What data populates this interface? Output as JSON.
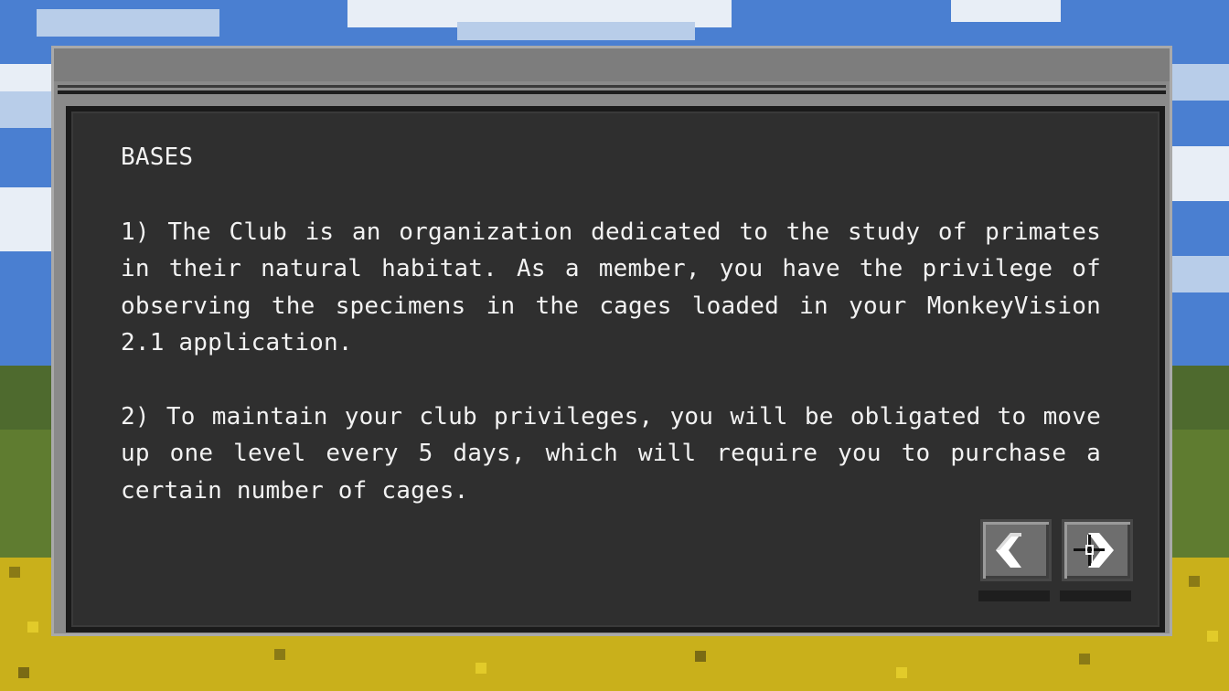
{
  "dialog": {
    "heading": "BASES",
    "paragraphs": [
      "1) The Club is an organization dedicated to the study of primates in their natural habitat. As a member, you have the privilege of observing the specimens in the cages loaded in your MonkeyVision 2.1 application.",
      "2) To maintain your club privileges, you will be obligated to move up one level every 5 days, which will require you to purchase a certain number of cages."
    ]
  },
  "navigation": {
    "previous_icon": "chevron-left-icon",
    "next_icon": "chevron-right-icon",
    "cursor_icon": "crosshair-cursor-icon"
  },
  "colors": {
    "panel_bg": "#2f2f2f",
    "window_frame": "#8a8a8a",
    "text": "#f2f2f2",
    "sky": "#4a7fd1",
    "grass": "#c9b01b"
  }
}
